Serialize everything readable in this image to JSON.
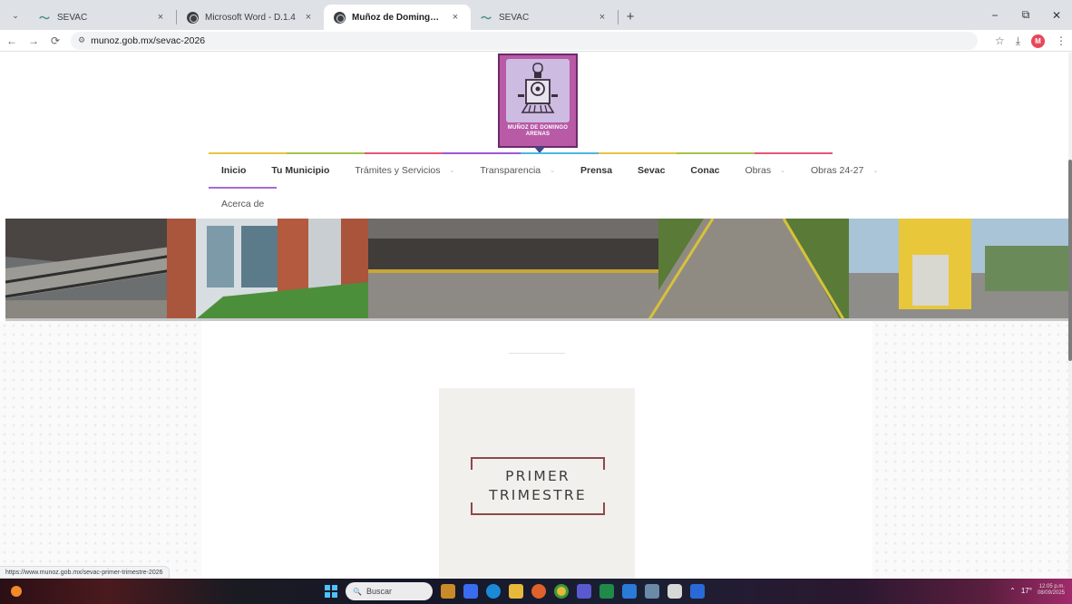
{
  "browser": {
    "tabs": [
      {
        "title": "SEVAC",
        "favicon": "sevac-icon",
        "active": false
      },
      {
        "title": "Microsoft Word - D.1.4",
        "favicon": "globe-icon",
        "active": false
      },
      {
        "title": "Muñoz de Domingo Arenas",
        "favicon": "globe-icon",
        "active": true
      },
      {
        "title": "SEVAC",
        "favicon": "sevac-icon",
        "active": false
      }
    ],
    "close_glyph": "×",
    "new_tab_glyph": "+",
    "tab_menu_glyph": "⌄",
    "window_controls": {
      "minimize": "−",
      "restore": "⧉",
      "close": "✕"
    },
    "url": "munoz.gob.mx/sevac-2026",
    "nav": {
      "back": "←",
      "forward": "→",
      "reload": "⟳"
    },
    "toolbar_icons": {
      "bookmark": "☆",
      "download": "⤓",
      "menu": "⋮"
    },
    "profile_initial": "M"
  },
  "site": {
    "logo_text": "MUÑOZ DE DOMINGO ARENAS",
    "nav_items": [
      {
        "label": "Inicio",
        "bold": true,
        "dropdown": false
      },
      {
        "label": "Tu Municipio",
        "bold": true,
        "dropdown": false
      },
      {
        "label": "Trámites y Servicios",
        "bold": false,
        "dropdown": true
      },
      {
        "label": "Transparencia",
        "bold": false,
        "dropdown": true
      },
      {
        "label": "Prensa",
        "bold": true,
        "dropdown": false
      },
      {
        "label": "Sevac",
        "bold": true,
        "dropdown": false
      },
      {
        "label": "Conac",
        "bold": true,
        "dropdown": false
      },
      {
        "label": "Obras",
        "bold": false,
        "dropdown": true
      },
      {
        "label": "Obras 24-27",
        "bold": false,
        "dropdown": true
      }
    ],
    "nav_row2": [
      {
        "label": "Acerca de"
      }
    ],
    "dropdown_caret": "⌄",
    "nav_stripe_colors": [
      "#e6c441",
      "#a6c34a",
      "#e8547a",
      "#9a5ad6",
      "#49b8e0",
      "#e6c441",
      "#a6c34a",
      "#e8547a"
    ],
    "card": {
      "line1": "PRIMER",
      "line2": "TRIMESTRE"
    }
  },
  "status_url": "https://www.munoz.gob.mx/sevac-primer-trimestre-2026",
  "taskbar": {
    "search_placeholder": "Buscar",
    "search_icon": "🔍",
    "apps": [
      "explorer-icon",
      "edge-icon",
      "files-icon",
      "firefox-icon",
      "chrome-icon",
      "teams-icon",
      "store-icon",
      "photos-icon"
    ],
    "tray": {
      "temp": "17°",
      "time": "12:05 p.m.",
      "date": "08/09/2025"
    }
  }
}
